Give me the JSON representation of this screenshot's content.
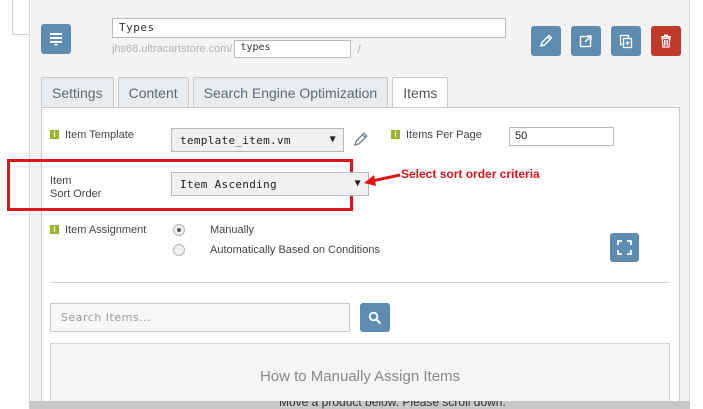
{
  "header": {
    "title_value": "Types",
    "url_base": "jhs68.ultracartstore.com/",
    "slug_value": "types",
    "url_suffix": "/"
  },
  "tabs": [
    {
      "label": "Settings",
      "active": false
    },
    {
      "label": "Content",
      "active": false
    },
    {
      "label": "Search Engine Optimization",
      "active": false
    },
    {
      "label": "Items",
      "active": true
    }
  ],
  "items_tab": {
    "item_template": {
      "label": "Item Template",
      "value": "template_item.vm"
    },
    "items_per_page": {
      "label": "Items Per Page",
      "value": "50"
    },
    "sort_order": {
      "label_line1": "Item",
      "label_line2": "Sort Order",
      "value": "Item Ascending"
    },
    "annotation": "Select sort order criteria",
    "item_assignment": {
      "label": "Item Assignment",
      "options": [
        {
          "label": "Manually",
          "checked": true
        },
        {
          "label": "Automatically Based on Conditions",
          "checked": false
        }
      ]
    },
    "search": {
      "placeholder": "Search Items..."
    },
    "help": {
      "title": "How to Manually Assign Items",
      "cutoff_text": "Move a product below. Please scroll down."
    }
  },
  "colors": {
    "accent_blue": "#5e8bb0",
    "delete_red": "#c0392b",
    "highlight_red": "#e0141b",
    "info_green": "#9cb429"
  },
  "icons": {
    "header": "list-icon",
    "edit": "pencil-icon",
    "open": "external-link-icon",
    "copy": "copy-icon",
    "delete": "trash-icon",
    "expand": "fullscreen-icon",
    "search": "search-icon"
  }
}
